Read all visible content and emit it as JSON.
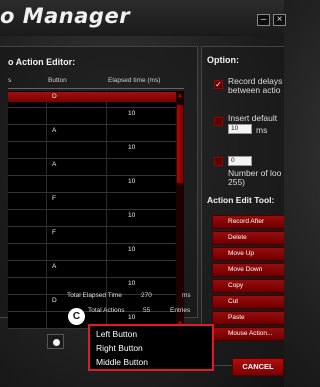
{
  "window": {
    "title": "o Manager",
    "minimize_icon": "minimize-icon",
    "close_icon": "close-icon"
  },
  "editor": {
    "title": "o Action Editor:",
    "columns": [
      "s",
      "Button",
      "Elapsed time (ms)"
    ],
    "rows": [
      {
        "button": "D",
        "time": ""
      },
      {
        "button": "",
        "time": "10"
      },
      {
        "button": "A",
        "time": ""
      },
      {
        "button": "",
        "time": "10"
      },
      {
        "button": "A",
        "time": ""
      },
      {
        "button": "",
        "time": "10"
      },
      {
        "button": "F",
        "time": ""
      },
      {
        "button": "",
        "time": "10"
      },
      {
        "button": "F",
        "time": ""
      },
      {
        "button": "",
        "time": "10"
      },
      {
        "button": "A",
        "time": ""
      },
      {
        "button": "",
        "time": "10"
      },
      {
        "button": "D",
        "time": ""
      },
      {
        "button": "",
        "time": "10"
      }
    ],
    "total_elapsed_label": "Total Elapsed Time",
    "total_elapsed_value": "270",
    "total_elapsed_unit": "ms",
    "total_actions_label": "Total Actions",
    "total_actions_value": "55",
    "total_actions_unit": "Entries"
  },
  "options": {
    "title": "Option:",
    "record_delays_line1": "Record delays",
    "record_delays_line2": "between actio",
    "record_delays_checked": "✓",
    "insert_default_line1": "Insert default",
    "insert_default_value": "10",
    "insert_default_unit": "ms",
    "loops_value": "0",
    "loops_line1": "Number of loo",
    "loops_line2": "255)"
  },
  "tools": {
    "title": "Action Edit Tool:",
    "buttons": [
      "Record After",
      "Delete",
      "Move Up",
      "Move Down",
      "Copy",
      "Cut",
      "Paste",
      "Mouse Action..."
    ]
  },
  "cancel_label": "CANCEL",
  "callout_marker": "C",
  "mouse_menu": {
    "items": [
      "Left Button",
      "Right Button",
      "Middle Button"
    ]
  },
  "colors": {
    "accent": "#9a0b0b",
    "highlight_border": "#e21b22"
  }
}
